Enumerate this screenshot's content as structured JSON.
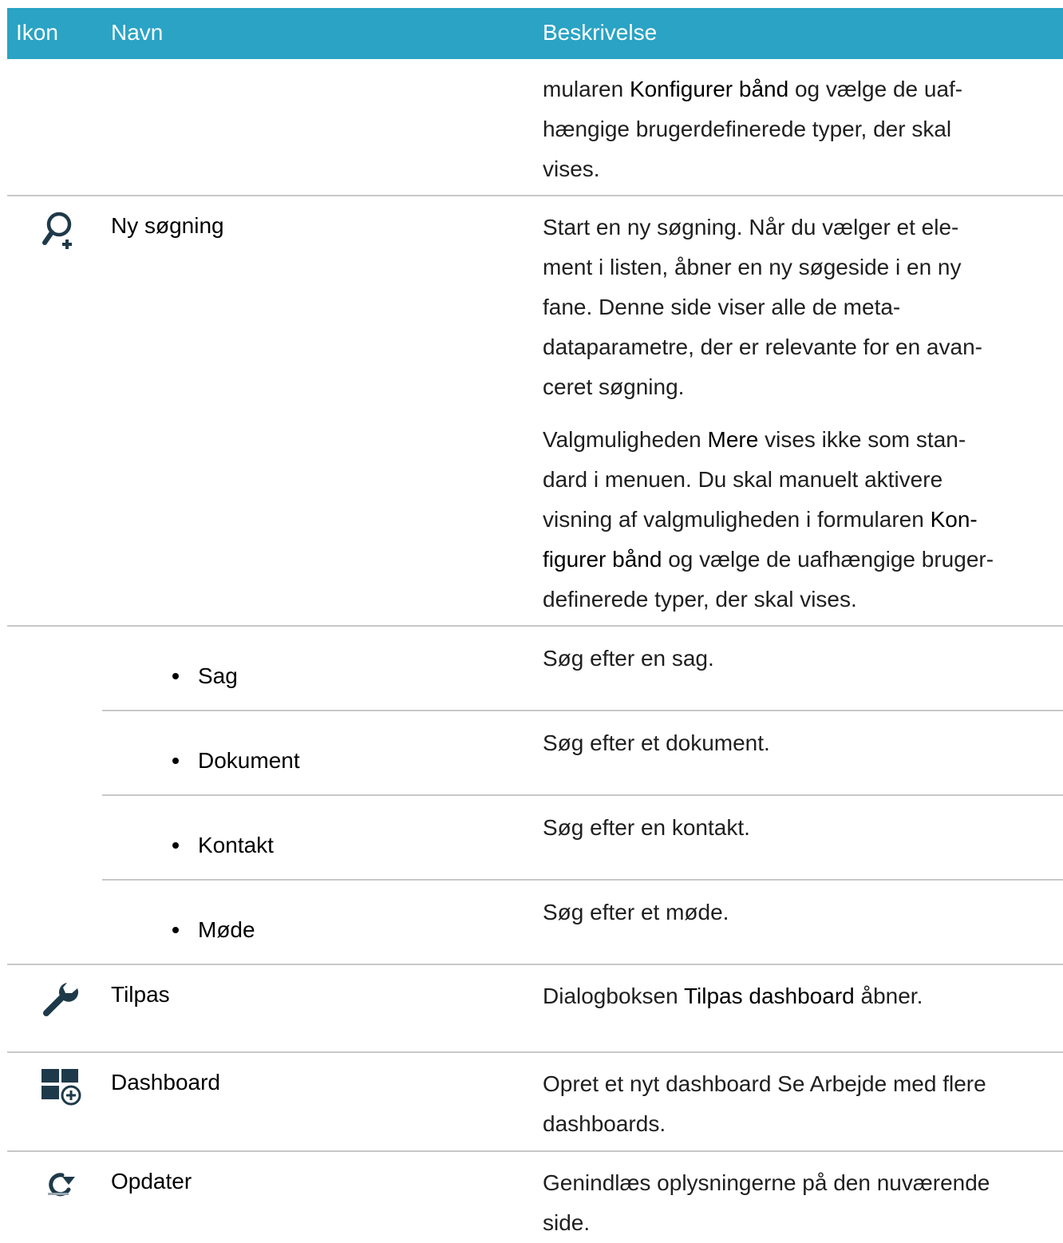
{
  "header": {
    "col_icon": "Ikon",
    "col_name": "Navn",
    "col_desc": "Beskrivelse"
  },
  "rows": {
    "cont": {
      "desc_l1_pre": "mularen ",
      "desc_l1_bold": "Konfigurer bånd",
      "desc_l1_post": " og vælge de uaf-",
      "desc_l2": "hængige brugerdefinerede typer, der skal",
      "desc_l3": "vises."
    },
    "ny_sogning": {
      "icon": "search-add-icon",
      "name": "Ny søgning",
      "p1_l1": "Start en ny søgning. Når du vælger et ele-",
      "p1_l2": "ment i listen, åbner en ny søgeside i en ny",
      "p1_l3": "fane. Denne side viser alle de meta-",
      "p1_l4": "dataparametre, der er relevante for en avan-",
      "p1_l5": "ceret søgning.",
      "p2_l1_pre": "Valgmuligheden ",
      "p2_l1_bold": "Mere",
      "p2_l1_post": " vises ikke som stan-",
      "p2_l2": "dard i menuen. Du skal manuelt aktivere",
      "p2_l3_pre": "visning af valgmuligheden i formularen ",
      "p2_l3_bold": "Kon-",
      "p2_l4_bold": "figurer bånd",
      "p2_l4_post": " og vælge de uafhængige bruger-",
      "p2_l5": "definerede typer, der skal vises."
    },
    "sag": {
      "name": "Sag",
      "desc": "Søg efter en sag."
    },
    "dokument": {
      "name": "Dokument",
      "desc": "Søg efter et dokument."
    },
    "kontakt": {
      "name": "Kontakt",
      "desc": "Søg efter en kontakt."
    },
    "mode": {
      "name": "Møde",
      "desc": "Søg efter et møde."
    },
    "tilpas": {
      "icon": "wrench-icon",
      "name": "Tilpas",
      "desc_pre": "Dialogboksen ",
      "desc_bold": "Tilpas dashboard",
      "desc_post": " åbner."
    },
    "dashboard": {
      "icon": "dashboard-add-icon",
      "name": "Dashboard",
      "desc_l1": "Opret et nyt dashboard Se Arbejde med flere",
      "desc_l2": "dashboards."
    },
    "opdater": {
      "icon": "refresh-icon",
      "name": "Opdater",
      "desc_l1": "Genindlæs oplysningerne på den nuværende",
      "desc_l2": "side."
    }
  },
  "colors": {
    "header_bg": "#2aa3c4",
    "header_text": "#ffffff",
    "icon": "#1e3a4a",
    "rule": "#c8c8c8"
  }
}
